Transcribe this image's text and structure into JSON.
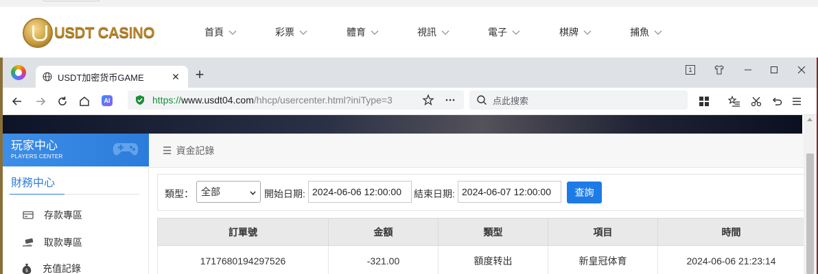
{
  "site": {
    "logo_text": "USDT CASINO",
    "nav": [
      {
        "label": "首頁"
      },
      {
        "label": "彩票"
      },
      {
        "label": "體育"
      },
      {
        "label": "視訊"
      },
      {
        "label": "電子"
      },
      {
        "label": "棋牌"
      },
      {
        "label": "捕魚"
      }
    ]
  },
  "browser": {
    "tab_title": "USDT加密货币GAME",
    "tab_close": "✕",
    "new_tab": "+",
    "tab_counter": "1",
    "ai_badge": "AI",
    "url": {
      "scheme": "https://",
      "host": "www.usdt04.com",
      "path": "/hhcp/usercenter.html?iniType=3"
    },
    "search_placeholder": "点此搜索",
    "window_controls": [
      "minimize",
      "maximize",
      "close"
    ]
  },
  "sidebar": {
    "title": "玩家中心",
    "subtitle": "PLAYERS CENTER",
    "section": "財務中心",
    "items": [
      {
        "label": "存款專區",
        "icon": "card-icon"
      },
      {
        "label": "取款專區",
        "icon": "cash-hand-icon"
      },
      {
        "label": "充值記錄",
        "icon": "money-bag-icon"
      }
    ]
  },
  "main": {
    "page_title": "資金記錄",
    "filter": {
      "type_label": "類型：",
      "type_value": "全部",
      "start_label": "開始日期:",
      "start_value": "2024-06-06 12:00:00",
      "end_label": "結束日期:",
      "end_value": "2024-06-07 12:00:00",
      "query_button": "查詢"
    },
    "table": {
      "headers": [
        "訂單號",
        "金額",
        "類型",
        "項目",
        "時間"
      ],
      "rows": [
        [
          "1717680194297526",
          "-321.00",
          "額度转出",
          "新皇冠体育",
          "2024-06-06 21:23:14"
        ]
      ]
    }
  },
  "colors": {
    "accent": "#2b7cdb",
    "button": "#1e7be6",
    "secure_green": "#1a8f3a",
    "logo_gold": "#b8862b"
  }
}
